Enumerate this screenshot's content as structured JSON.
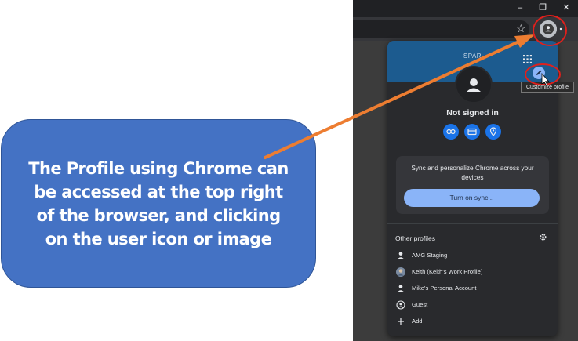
{
  "callout": {
    "text": "The Profile using Chrome can be accessed at the top right of the browser, and clicking on the user icon or image"
  },
  "window_controls": {
    "minimize": "–",
    "restore": "❐",
    "close": "✕"
  },
  "toolbar": {
    "bookmark_star": "☆"
  },
  "profile_menu": {
    "banner_title": "SPAR",
    "status": "Not signed in",
    "quick_actions": [
      "password-key-icon",
      "payment-card-icon",
      "location-pin-icon"
    ],
    "sync": {
      "description": "Sync and personalize Chrome across your devices",
      "button": "Turn on sync..."
    },
    "other_profiles": {
      "title": "Other profiles",
      "items": [
        {
          "label": "AMG Staging",
          "icon": "person-icon"
        },
        {
          "label": "Keith (Keith's Work Profile)",
          "icon": "photo-avatar-icon"
        },
        {
          "label": "Mike's Personal Account",
          "icon": "person-icon"
        },
        {
          "label": "Guest",
          "icon": "guest-icon"
        },
        {
          "label": "Add",
          "icon": "plus-icon"
        }
      ]
    }
  },
  "tooltip": {
    "text": "Customize profile"
  },
  "colors": {
    "callout": "#4472c4",
    "highlight_ring": "#e0201c",
    "arrow": "#ed7d31",
    "sync_button": "#8ab4f8",
    "banner": "#1c5b8f"
  }
}
